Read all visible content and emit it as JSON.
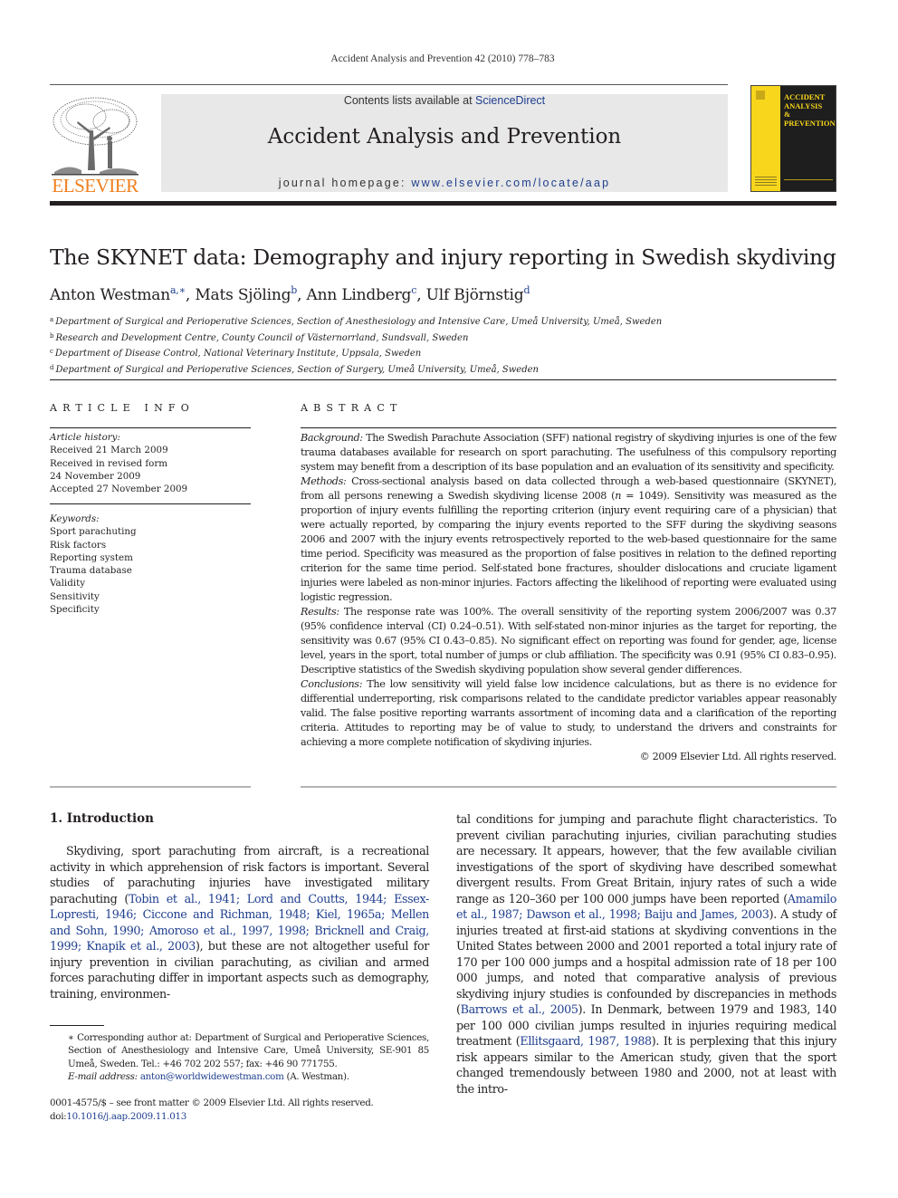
{
  "running_head": "Accident Analysis and Prevention 42 (2010) 778–783",
  "masthead": {
    "publisher_wordmark": "ELSEVIER",
    "publisher_logo_icon": "elsevier-tree-icon",
    "contents_prefix": "Contents lists available at ",
    "contents_link": "ScienceDirect",
    "journal_name": "Accident Analysis and Prevention",
    "homepage_prefix": "journal homepage: ",
    "homepage_link": "www.elsevier.com/locate/aap",
    "cover": {
      "line1": "ACCIDENT",
      "line2": "ANALYSIS",
      "line3": "&",
      "line4": "PREVENTION"
    }
  },
  "article": {
    "title": "The SKYNET data: Demography and injury reporting in Swedish skydiving",
    "authors": [
      {
        "name": "Anton Westman",
        "sup": "a,∗",
        "sep": ", "
      },
      {
        "name": "Mats Sjöling",
        "sup": "b",
        "sep": ", "
      },
      {
        "name": "Ann Lindberg",
        "sup": "c",
        "sep": ", "
      },
      {
        "name": "Ulf Björnstig",
        "sup": "d",
        "sep": ""
      }
    ],
    "affiliations": [
      {
        "key": "a",
        "text": "Department of Surgical and Perioperative Sciences, Section of Anesthesiology and Intensive Care, Umeå University, Umeå, Sweden"
      },
      {
        "key": "b",
        "text": "Research and Development Centre, County Council of Västernorrland, Sundsvall, Sweden"
      },
      {
        "key": "c",
        "text": "Department of Disease Control, National Veterinary Institute, Uppsala, Sweden"
      },
      {
        "key": "d",
        "text": "Department of Surgical and Perioperative Sciences, Section of Surgery, Umeå University, Umeå, Sweden"
      }
    ]
  },
  "article_info": {
    "heading": "ARTICLE INFO",
    "history_label": "Article history:",
    "history": [
      "Received 21 March 2009",
      "Received in revised form",
      "24 November 2009",
      "Accepted 27 November 2009"
    ],
    "keywords_label": "Keywords:",
    "keywords": [
      "Sport parachuting",
      "Risk factors",
      "Reporting system",
      "Trauma database",
      "Validity",
      "Sensitivity",
      "Specificity"
    ]
  },
  "abstract": {
    "heading": "ABSTRACT",
    "background_label": "Background:",
    "background": " The Swedish Parachute Association (SFF) national registry of skydiving injuries is one of the few trauma databases available for research on sport parachuting. The usefulness of this compulsory reporting system may benefit from a description of its base population and an evaluation of its sensitivity and specificity.",
    "methods_label": "Methods:",
    "methods_a": " Cross-sectional analysis based on data collected through a web-based questionnaire (SKYNET), from all persons renewing a Swedish skydiving license 2008 (",
    "methods_n": "n",
    "methods_b": " = 1049). Sensitivity was measured as the proportion of injury events fulfilling the reporting criterion (injury event requiring care of a physician) that were actually reported, by comparing the injury events reported to the SFF during the skydiving seasons 2006 and 2007 with the injury events retrospectively reported to the web-based questionnaire for the same time period. Specificity was measured as the proportion of false positives in relation to the defined reporting criterion for the same time period. Self-stated bone fractures, shoulder dislocations and cruciate ligament injuries were labeled as non-minor injuries. Factors affecting the likelihood of reporting were evaluated using logistic regression.",
    "results_label": "Results:",
    "results": " The response rate was 100%. The overall sensitivity of the reporting system 2006/2007 was 0.37 (95% confidence interval (CI) 0.24–0.51). With self-stated non-minor injuries as the target for reporting, the sensitivity was 0.67 (95% CI 0.43–0.85). No significant effect on reporting was found for gender, age, license level, years in the sport, total number of jumps or club affiliation. The specificity was 0.91 (95% CI 0.83–0.95). Descriptive statistics of the Swedish skydiving population show several gender differences.",
    "conclusions_label": "Conclusions:",
    "conclusions": " The low sensitivity will yield false low incidence calculations, but as there is no evidence for differential underreporting, risk comparisons related to the candidate predictor variables appear reasonably valid. The false positive reporting warrants assortment of incoming data and a clarification of the reporting criteria. Attitudes to reporting may be of value to study, to understand the drivers and constraints for achieving a more complete notification of skydiving injuries.",
    "copyright": "© 2009 Elsevier Ltd. All rights reserved."
  },
  "introduction": {
    "heading": "1.  Introduction",
    "left": {
      "t1": "Skydiving, sport parachuting from aircraft, is a recreational activity in which apprehension of risk factors is important. Several studies of parachuting injuries have investigated military parachuting (",
      "c1": "Tobin et al., 1941; Lord and Coutts, 1944; Essex-Lopresti, 1946; Ciccone and Richman, 1948; Kiel, 1965a; Mellen and Sohn, 1990; Amoroso et al., 1997, 1998; Bricknell and Craig, 1999; Knapik et al., 2003",
      "t2": "), but these are not altogether useful for injury prevention in civilian parachuting, as civilian and armed forces parachuting differ in important aspects such as demography, training, environmen-"
    },
    "right": {
      "t1": "tal conditions for jumping and parachute flight characteristics. To prevent civilian parachuting injuries, civilian parachuting studies are necessary. It appears, however, that the few available civilian investigations of the sport of skydiving have described somewhat divergent results. From Great Britain, injury rates of such a wide range as 120–360 per 100 000 jumps have been reported (",
      "c1": "Amamilo et al., 1987; Dawson et al., 1998; Baiju and James, 2003",
      "t2": "). A study of injuries treated at first-aid stations at skydiving conventions in the United States between 2000 and 2001 reported a total injury rate of 170 per 100 000 jumps and a hospital admission rate of 18 per 100 000 jumps, and noted that comparative analysis of previous skydiving injury studies is confounded by discrepancies in methods (",
      "c2": "Barrows et al., 2005",
      "t3": "). In Denmark, between 1979 and 1983, 140 per 100 000 civilian jumps resulted in injuries requiring medical treatment (",
      "c3": "Ellitsgaard, 1987, 1988",
      "t4": "). It is perplexing that this injury risk appears similar to the American study, given that the sport changed tremendously between 1980 and 2000, not at least with the intro-"
    }
  },
  "footnote": {
    "corresponding": "∗ Corresponding author at: Department of Surgical and Perioperative Sciences, Section of Anesthesiology and Intensive Care, Umeå University, SE-901 85 Umeå, Sweden. Tel.: +46 702 202 557; fax: +46 90 771755.",
    "email_label": "E-mail address:",
    "email": "anton@worldwidewestman.com",
    "email_suffix": " (A. Westman)."
  },
  "front_matter": {
    "issn_line": "0001-4575/$ – see front matter © 2009 Elsevier Ltd. All rights reserved.",
    "doi_prefix": "doi:",
    "doi": "10.1016/j.aap.2009.11.013"
  },
  "colors": {
    "link": "#1e3e8e",
    "elsevier_orange": "#f07f1e",
    "cover_yellow": "#f8d61c",
    "masthead_gray": "#e8e8e8"
  }
}
